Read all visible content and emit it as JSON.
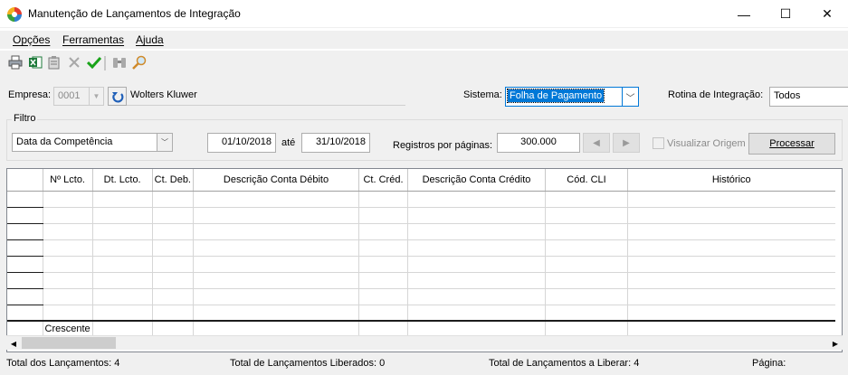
{
  "window": {
    "title": "Manutenção de Lançamentos de Integração",
    "min_glyph": "—",
    "max_glyph": "☐",
    "close_glyph": "✕"
  },
  "menu": [
    "Opções",
    "Ferramentas",
    "Ajuda"
  ],
  "toolbar_icons": [
    "printer-icon",
    "excel-export-icon",
    "clipboard-icon",
    "delete-icon",
    "confirm-check-icon",
    "binoculars-icon",
    "search-icon"
  ],
  "empresa": {
    "label": "Empresa:",
    "code": "0001",
    "name": "Wolters Kluwer"
  },
  "sistema": {
    "label": "Sistema:",
    "value": "Folha de Pagamento"
  },
  "rotina": {
    "label": "Rotina de Integração:",
    "value": "Todos"
  },
  "filtro": {
    "legend": "Filtro",
    "tipo": "Data da Competência",
    "data_inicio": "01/10/2018",
    "ate_label": "até",
    "data_fim": "31/10/2018",
    "registros_label": "Registros por páginas:",
    "registros_value": "300.000",
    "visualizar_origem_label": "Visualizar Origem",
    "processar_label": "Processar"
  },
  "grid": {
    "columns": [
      "",
      "Nº Lcto.",
      "Dt. Lcto.",
      "Ct. Deb.",
      "Descrição Conta Débito",
      "Ct. Créd.",
      "Descrição Conta Crédito",
      "Cód. CLI",
      "Histórico"
    ],
    "empty_row_count": 8,
    "footer_cell": "Crescente"
  },
  "status": {
    "total_lancamentos": "Total dos Lançamentos: 4",
    "total_liberados": "Total de Lançamentos Liberados: 0",
    "total_a_liberar": "Total de Lançamentos a Liberar: 4",
    "pagina": "Página:"
  },
  "colors": {
    "panel_bg": "#f0f0f0",
    "selection": "#0078d7",
    "check_green": "#19a319",
    "excel_green": "#1d7a3a"
  }
}
